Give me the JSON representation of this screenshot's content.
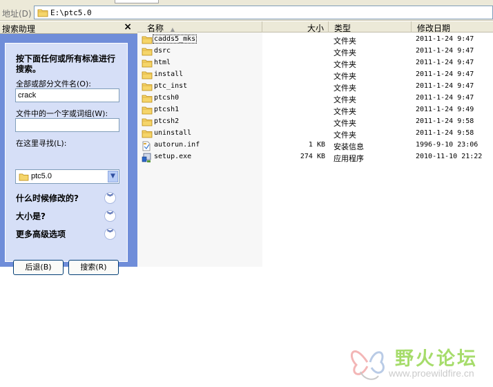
{
  "address": {
    "label": "地址(D)",
    "path": "E:\\ptc5.0"
  },
  "search_pane": {
    "title": "搜索助理",
    "close_glyph": "×",
    "heading": "按下面任何或所有标准进行搜索。",
    "filename_label": "全部或部分文件名(O):",
    "filename_value": "crack",
    "phrase_label": "文件中的一个字或词组(W):",
    "phrase_value": "",
    "lookin_label": "在这里寻找(L):",
    "lookin_value": "ptc5.0",
    "options": [
      {
        "label": "什么时候修改的?",
        "icon": "chevron-double-down-icon"
      },
      {
        "label": "大小是?",
        "icon": "chevron-double-down-icon"
      },
      {
        "label": "更多高级选项",
        "icon": "chevron-double-down-icon"
      }
    ],
    "back_button": "后退(B)",
    "search_button": "搜索(R)"
  },
  "file_list": {
    "columns": {
      "name": "名称",
      "size": "大小",
      "type": "类型",
      "modified": "修改日期"
    },
    "sort_indicator": "▲",
    "rows": [
      {
        "name": "cadds5_mks",
        "size": "",
        "type": "文件夹",
        "modified": "2011-1-24 9:47",
        "icon": "folder-icon"
      },
      {
        "name": "dsrc",
        "size": "",
        "type": "文件夹",
        "modified": "2011-1-24 9:47",
        "icon": "folder-icon"
      },
      {
        "name": "html",
        "size": "",
        "type": "文件夹",
        "modified": "2011-1-24 9:47",
        "icon": "folder-icon"
      },
      {
        "name": "install",
        "size": "",
        "type": "文件夹",
        "modified": "2011-1-24 9:47",
        "icon": "folder-icon"
      },
      {
        "name": "ptc_inst",
        "size": "",
        "type": "文件夹",
        "modified": "2011-1-24 9:47",
        "icon": "folder-icon"
      },
      {
        "name": "ptcsh0",
        "size": "",
        "type": "文件夹",
        "modified": "2011-1-24 9:47",
        "icon": "folder-icon"
      },
      {
        "name": "ptcsh1",
        "size": "",
        "type": "文件夹",
        "modified": "2011-1-24 9:49",
        "icon": "folder-icon"
      },
      {
        "name": "ptcsh2",
        "size": "",
        "type": "文件夹",
        "modified": "2011-1-24 9:58",
        "icon": "folder-icon"
      },
      {
        "name": "uninstall",
        "size": "",
        "type": "文件夹",
        "modified": "2011-1-24 9:58",
        "icon": "folder-icon"
      },
      {
        "name": "autorun.inf",
        "size": "1 KB",
        "type": "安装信息",
        "modified": "1996-9-10 23:06",
        "icon": "setup-info-file-icon"
      },
      {
        "name": "setup.exe",
        "size": "274 KB",
        "type": "应用程序",
        "modified": "2010-11-10 21:22",
        "icon": "application-exe-icon"
      }
    ]
  },
  "watermark": {
    "text": "野火论坛",
    "url": "www.proewildfire.cn",
    "logo_icon": "butterfly-logo-icon"
  },
  "colors": {
    "pane_blue": "#6f8dd9",
    "pane_body": "#d6dff7",
    "chrome": "#ece9d8",
    "folder_yellow": "#f5d56a",
    "watermark_green": "#a6dc6b"
  }
}
